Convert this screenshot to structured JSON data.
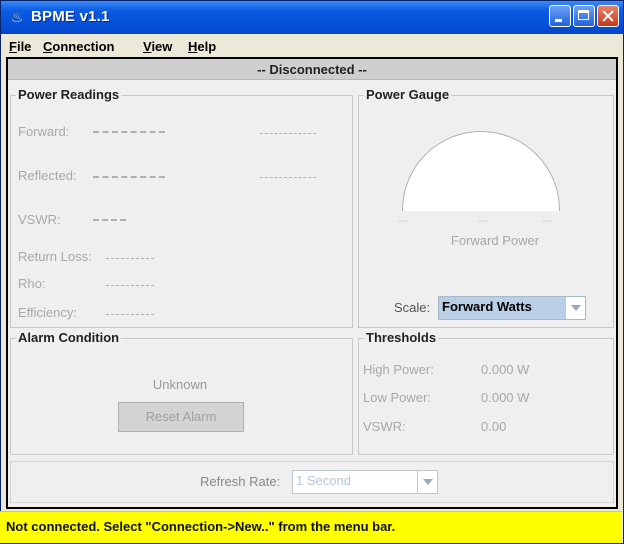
{
  "window": {
    "title": "BPME v1.1"
  },
  "menu": [
    {
      "key": "F",
      "rest": "ile"
    },
    {
      "key": "C",
      "rest": "onnection"
    },
    {
      "key": "V",
      "rest": "iew"
    },
    {
      "key": "H",
      "rest": "elp"
    }
  ],
  "connection_status": "-- Disconnected --",
  "power_readings": {
    "title": "Power Readings",
    "forward_label": "Forward:",
    "reflected_label": "Reflected:",
    "vswr_label": "VSWR:",
    "return_loss_label": "Return Loss:",
    "rho_label": "Rho:",
    "efficiency_label": "Efficiency:"
  },
  "power_gauge": {
    "title": "Power Gauge",
    "tick_left": "---",
    "tick_mid": "---",
    "tick_right": "---",
    "caption": "Forward Power",
    "scale_label": "Scale:",
    "scale_value": "Forward Watts"
  },
  "alarm": {
    "title": "Alarm Condition",
    "state": "Unknown",
    "reset_label": "Reset Alarm"
  },
  "thresholds": {
    "title": "Thresholds",
    "high_label": "High Power:",
    "high_value": "0.000 W",
    "low_label": "Low Power:",
    "low_value": "0.000 W",
    "vswr_label": "VSWR:",
    "vswr_value": "0.00"
  },
  "refresh": {
    "label": "Refresh Rate:",
    "value": "1 Second"
  },
  "status_bar": "Not connected. Select \"Connection->New..\" from the menu bar.",
  "colors": {
    "titlebar": "#0550d8",
    "status_bg": "#ffff00",
    "combo_bg": "#b8cfe6"
  }
}
